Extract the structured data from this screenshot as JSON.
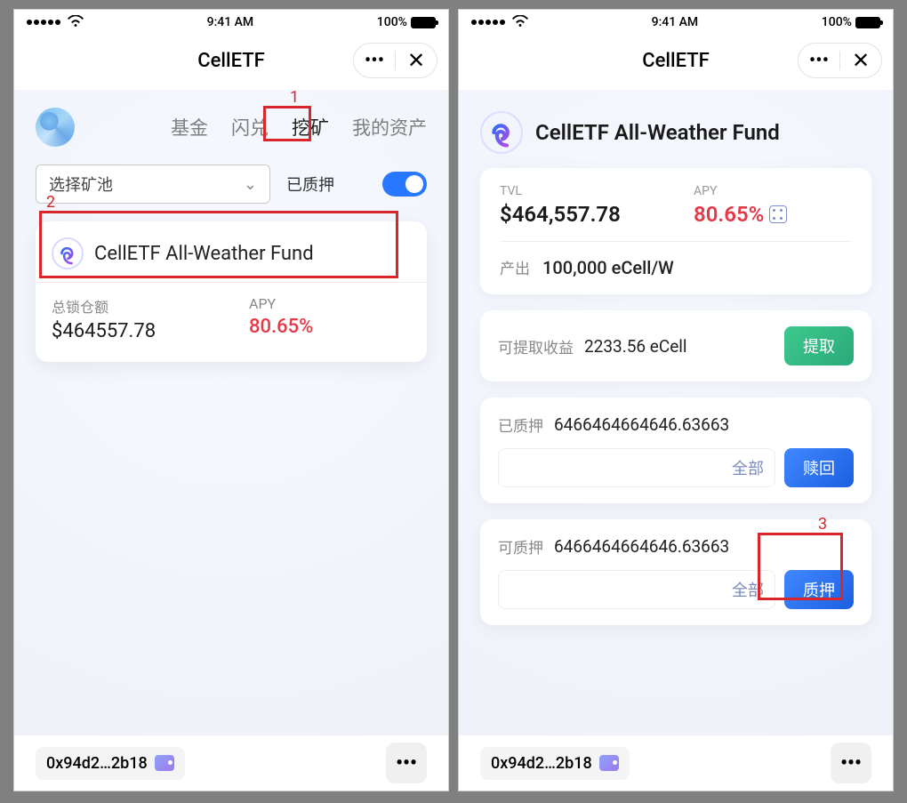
{
  "status": {
    "time": "9:41 AM",
    "battery": "100%"
  },
  "app": {
    "title": "CellETF",
    "tabs": [
      "基金",
      "闪兑",
      "挖矿",
      "我的资产"
    ],
    "active_tab_index": 2
  },
  "left": {
    "select_placeholder": "选择矿池",
    "toggle_label": "已质押",
    "fund": {
      "name": "CellETF All-Weather Fund",
      "tvl_label": "总锁仓额",
      "tvl_value": "$464557.78",
      "apy_label": "APY",
      "apy_value": "80.65%"
    }
  },
  "right": {
    "fund_title": "CellETF All-Weather Fund",
    "tvl_label": "TVL",
    "tvl_value": "$464,557.78",
    "apy_label": "APY",
    "apy_value": "80.65%",
    "output_label": "产出",
    "output_value": "100,000 eCell/W",
    "withdraw": {
      "label": "可提取收益",
      "value": "2233.56 eCell",
      "btn": "提取"
    },
    "staked": {
      "label": "已质押",
      "value": "6466464664646.63663",
      "all": "全部",
      "btn": "赎回"
    },
    "stakeable": {
      "label": "可质押",
      "value": "6466464664646.63663",
      "all": "全部",
      "btn": "质押"
    }
  },
  "footer": {
    "wallet": "0x94d2…2b18",
    "more": "•••"
  },
  "annotations": {
    "n1": "1",
    "n2": "2",
    "n3": "3"
  }
}
